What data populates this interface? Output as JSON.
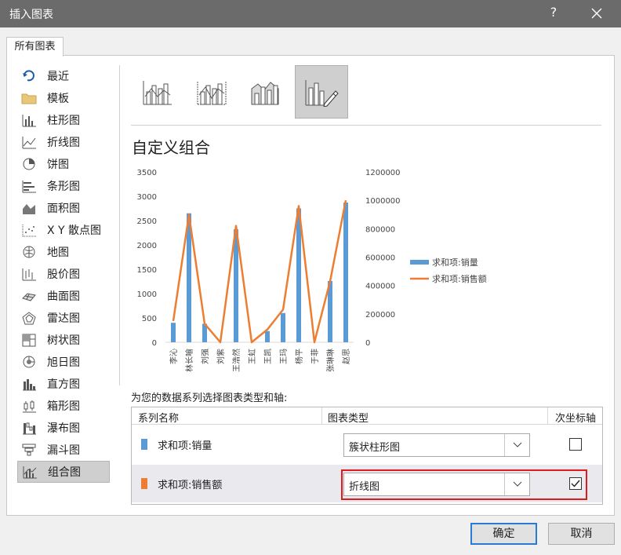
{
  "window": {
    "title": "插入图表",
    "help_label": "?"
  },
  "tab": {
    "label": "所有图表"
  },
  "sidebar": {
    "items": [
      {
        "label": "最近",
        "icon": "recent-icon"
      },
      {
        "label": "模板",
        "icon": "folder-icon"
      },
      {
        "label": "柱形图",
        "icon": "column-chart-icon"
      },
      {
        "label": "折线图",
        "icon": "line-chart-icon"
      },
      {
        "label": "饼图",
        "icon": "pie-chart-icon"
      },
      {
        "label": "条形图",
        "icon": "bar-chart-icon"
      },
      {
        "label": "面积图",
        "icon": "area-chart-icon"
      },
      {
        "label": "X Y 散点图",
        "icon": "scatter-chart-icon"
      },
      {
        "label": "地图",
        "icon": "map-chart-icon"
      },
      {
        "label": "股价图",
        "icon": "stock-chart-icon"
      },
      {
        "label": "曲面图",
        "icon": "surface-chart-icon"
      },
      {
        "label": "雷达图",
        "icon": "radar-chart-icon"
      },
      {
        "label": "树状图",
        "icon": "treemap-chart-icon"
      },
      {
        "label": "旭日图",
        "icon": "sunburst-chart-icon"
      },
      {
        "label": "直方图",
        "icon": "histogram-chart-icon"
      },
      {
        "label": "箱形图",
        "icon": "box-whisker-chart-icon"
      },
      {
        "label": "瀑布图",
        "icon": "waterfall-chart-icon"
      },
      {
        "label": "漏斗图",
        "icon": "funnel-chart-icon"
      },
      {
        "label": "组合图",
        "icon": "combo-chart-icon",
        "selected": true
      }
    ]
  },
  "combo_types": {
    "section_title": "自定义组合",
    "selected_index": 3
  },
  "chart_data": {
    "type": "bar",
    "categories": [
      "李沁",
      "林长喻",
      "刘强",
      "刘紫",
      "王浩然",
      "王虹",
      "王凯",
      "王玛",
      "杨平",
      "于菲",
      "张琳琳",
      "赵思"
    ],
    "series": [
      {
        "name": "求和项:销量",
        "type": "bar",
        "axis": "primary",
        "values": [
          400,
          2650,
          380,
          0,
          2320,
          0,
          230,
          600,
          2750,
          0,
          1260,
          2870
        ]
      },
      {
        "name": "求和项:销售额",
        "type": "line",
        "axis": "secondary",
        "values": [
          150000,
          900000,
          130000,
          0,
          820000,
          0,
          90000,
          230000,
          960000,
          0,
          430000,
          1000000
        ]
      }
    ],
    "y_ticks": [
      "3500",
      "3000",
      "2500",
      "2000",
      "1500",
      "1000",
      "500",
      "0"
    ],
    "y2_ticks": [
      "1200000",
      "1000000",
      "800000",
      "600000",
      "400000",
      "200000",
      "0"
    ],
    "ylim": [
      0,
      3500
    ],
    "y2lim": [
      0,
      1200000
    ],
    "legend_position": "right",
    "colors": {
      "bar": "#5b9bd5",
      "line": "#ed7d31"
    }
  },
  "series_section": {
    "caption": "为您的数据系列选择图表类型和轴:",
    "headers": {
      "name": "系列名称",
      "type": "图表类型",
      "secondary": "次坐标轴"
    },
    "rows": [
      {
        "name": "求和项:销量",
        "chart_type": "簇状柱形图",
        "secondary_axis": false,
        "color": "#5b9bd5"
      },
      {
        "name": "求和项:销售额",
        "chart_type": "折线图",
        "secondary_axis": true,
        "color": "#ed7d31"
      }
    ]
  },
  "buttons": {
    "ok": "确定",
    "cancel": "取消"
  }
}
